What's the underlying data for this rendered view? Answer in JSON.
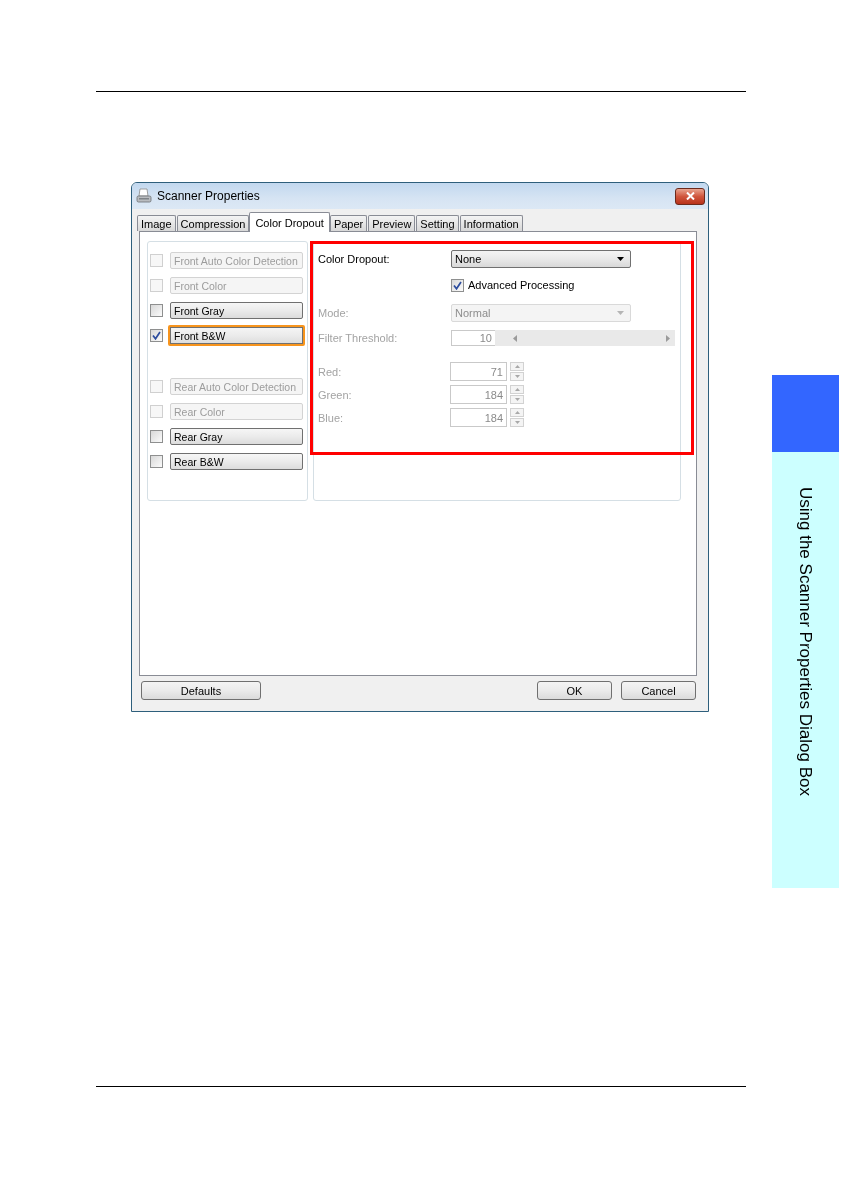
{
  "chapter_tab": {
    "label": "Using the Scanner Properties Dialog Box"
  },
  "window": {
    "title": "Scanner Properties"
  },
  "tabs": [
    {
      "label": "Image",
      "selected": false
    },
    {
      "label": "Compression",
      "selected": false
    },
    {
      "label": "Color Dropout",
      "selected": true
    },
    {
      "label": "Paper",
      "selected": false
    },
    {
      "label": "Preview",
      "selected": false
    },
    {
      "label": "Setting",
      "selected": false
    },
    {
      "label": "Information",
      "selected": false
    }
  ],
  "front_options": [
    {
      "label": "Front Auto Color Detection",
      "checked": false,
      "disabled": true,
      "selected": false
    },
    {
      "label": "Front Color",
      "checked": false,
      "disabled": true,
      "selected": false
    },
    {
      "label": "Front Gray",
      "checked": false,
      "disabled": false,
      "selected": false
    },
    {
      "label": "Front B&W",
      "checked": true,
      "disabled": false,
      "selected": true
    }
  ],
  "rear_options": [
    {
      "label": "Rear Auto Color Detection",
      "checked": false,
      "disabled": true,
      "selected": false
    },
    {
      "label": "Rear Color",
      "checked": false,
      "disabled": true,
      "selected": false
    },
    {
      "label": "Rear Gray",
      "checked": false,
      "disabled": false,
      "selected": false
    },
    {
      "label": "Rear B&W",
      "checked": false,
      "disabled": false,
      "selected": false
    }
  ],
  "settings": [
    {
      "kind": "dropdown",
      "label": "Color Dropout:",
      "value": "None",
      "disabled": false
    },
    {
      "kind": "checkbox",
      "label": "Advanced Processing",
      "checked": true,
      "disabled": false
    },
    {
      "kind": "dropdown",
      "label": "Mode:",
      "value": "Normal",
      "disabled": true
    },
    {
      "kind": "scroll",
      "label": "Filter Threshold:",
      "value": "10",
      "disabled": true
    },
    {
      "kind": "spin",
      "label": "Red:",
      "value": "71",
      "disabled": true
    },
    {
      "kind": "spin",
      "label": "Green:",
      "value": "184",
      "disabled": true
    },
    {
      "kind": "spin",
      "label": "Blue:",
      "value": "184",
      "disabled": true
    }
  ],
  "footer": {
    "left_buttons": [
      "Defaults"
    ],
    "right_buttons": [
      "OK",
      "Cancel"
    ]
  }
}
